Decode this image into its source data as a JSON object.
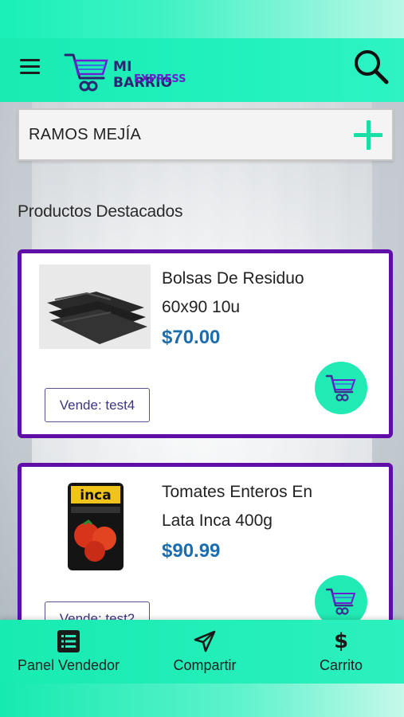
{
  "app": {
    "brand_top": "MI BARRIO",
    "brand_bottom": "EXPRESS"
  },
  "location": {
    "value": "RAMOS MEJÍA"
  },
  "section": {
    "title": "Productos Destacados"
  },
  "products": [
    {
      "name_line1": "Bolsas De Residuo",
      "name_line2": "60x90 10u",
      "price": "$70.00",
      "seller": "Vende: test4"
    },
    {
      "name_line1": "Tomates Enteros En",
      "name_line2": "Lata Inca 400g",
      "price": "$90.99",
      "seller": "Vende: test2",
      "image_brand": "inca"
    }
  ],
  "bottom_nav": {
    "panel_label": "Panel Vendedor",
    "share_label": "Compartir",
    "cart_label": "Carrito",
    "cart_symbol": "$"
  },
  "icons": {
    "menu": "menu-icon",
    "search": "search-icon",
    "add": "plus-icon",
    "cart": "cart-icon",
    "list": "list-icon",
    "share": "send-icon"
  },
  "colors": {
    "accent": "#1de9b6",
    "card_border": "#5f0fa8",
    "price": "#1a6eb0",
    "brand_dark": "#2a2570",
    "brand_purple": "#6b1fd1"
  }
}
